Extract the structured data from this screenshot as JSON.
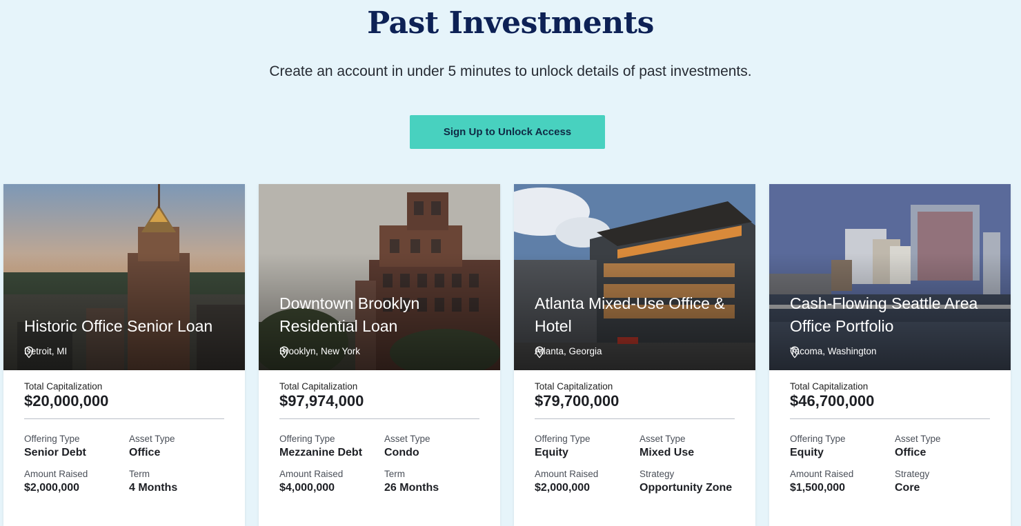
{
  "page": {
    "title": "Past Investments",
    "subtitle": "Create an account in under 5 minutes to unlock details of past investments.",
    "cta_label": "Sign Up to Unlock Access"
  },
  "cards": [
    {
      "title": "Historic Office Senior Loan",
      "location": "Detroit, MI",
      "total_cap_label": "Total Capitalization",
      "total_cap_value": "$20,000,000",
      "f1_label": "Offering Type",
      "f1_value": "Senior Debt",
      "f2_label": "Asset Type",
      "f2_value": "Office",
      "f3_label": "Amount Raised",
      "f3_value": "$2,000,000",
      "f4_label": "Term",
      "f4_value": "4 Months"
    },
    {
      "title": "Downtown Brooklyn Residential Loan",
      "location": "Brooklyn, New York",
      "total_cap_label": "Total Capitalization",
      "total_cap_value": "$97,974,000",
      "f1_label": "Offering Type",
      "f1_value": "Mezzanine Debt",
      "f2_label": "Asset Type",
      "f2_value": "Condo",
      "f3_label": "Amount Raised",
      "f3_value": "$4,000,000",
      "f4_label": "Term",
      "f4_value": "26 Months"
    },
    {
      "title": "Atlanta Mixed-Use Office & Hotel",
      "location": "Atlanta, Georgia",
      "total_cap_label": "Total Capitalization",
      "total_cap_value": "$79,700,000",
      "f1_label": "Offering Type",
      "f1_value": "Equity",
      "f2_label": "Asset Type",
      "f2_value": "Mixed Use",
      "f3_label": "Amount Raised",
      "f3_value": "$2,000,000",
      "f4_label": "Strategy",
      "f4_value": "Opportunity Zone"
    },
    {
      "title": "Cash-Flowing Seattle Area Office Portfolio",
      "location": "Tacoma, Washington",
      "total_cap_label": "Total Capitalization",
      "total_cap_value": "$46,700,000",
      "f1_label": "Offering Type",
      "f1_value": "Equity",
      "f2_label": "Asset Type",
      "f2_value": "Office",
      "f3_label": "Amount Raised",
      "f3_value": "$1,500,000",
      "f4_label": "Strategy",
      "f4_value": "Core"
    }
  ],
  "icons": {
    "location": "map-pin-icon"
  }
}
